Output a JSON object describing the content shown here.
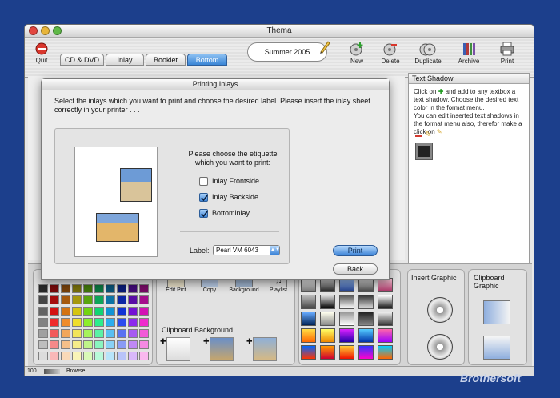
{
  "window": {
    "title": "Thema"
  },
  "toolbar": {
    "quit": "Quit",
    "tabs": [
      "CD & DVD",
      "Inlay",
      "Booklet",
      "Bottom"
    ],
    "active_tab": "Bottom",
    "document_name": "Summer 2005",
    "actions": [
      "New",
      "Delete",
      "Duplicate",
      "Archive",
      "Print"
    ]
  },
  "text_shadow_panel": {
    "title": "Text Shadow",
    "help_part1": "Click on",
    "help_part2": "and add to any textbox a text shadow. Choose the desired text color in the format menu.",
    "help_part3": "You can edit inserted text shadows in the format menu also, therefor make a click on"
  },
  "dialog": {
    "title": "Printing Inlays",
    "intro": "Select the inlays which you want to print and choose the desired label. Please insert the inlay sheet correctly in your printer . . .",
    "prompt": "Please choose the etiquette which you want to print:",
    "options": [
      {
        "label": "Inlay Frontside",
        "checked": false
      },
      {
        "label": "Inlay Backside",
        "checked": true
      },
      {
        "label": "Bottominlay",
        "checked": true
      }
    ],
    "label_caption": "Label:",
    "label_value": "Pearl VM 6043",
    "print_button": "Print",
    "back_button": "Back"
  },
  "bottom_panel": {
    "tools": [
      "Edit Pict",
      "Copy",
      "Background",
      "Playlist"
    ],
    "clipboard_background": "Clipboard Background",
    "insert_graphic": "Insert Graphic",
    "clipboard_graphic": "Clipboard Graphic"
  },
  "statusbar": {
    "zoom": "100",
    "browse": "Browse"
  },
  "watermark": "Brothersoft"
}
